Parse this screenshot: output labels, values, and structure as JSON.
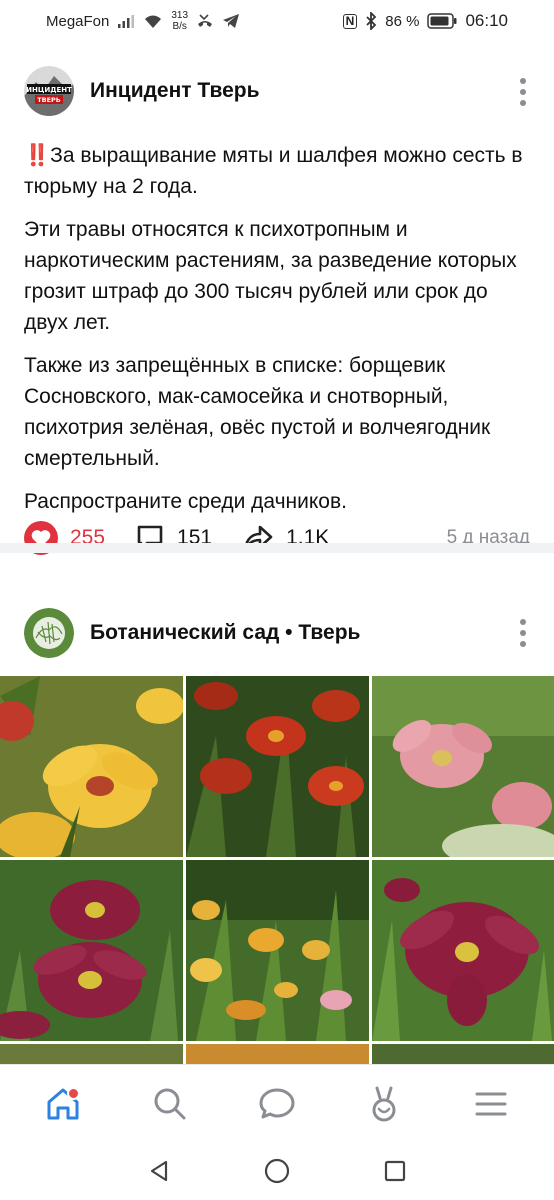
{
  "status_bar": {
    "carrier": "MegaFon",
    "net_speed_value": "313",
    "net_speed_unit": "B/s",
    "nfc": "N",
    "battery": "86 %",
    "time": "06:10"
  },
  "post1": {
    "author": "Инцидент Тверь",
    "avatar_text_1": "ИНЦИДЕНТ",
    "avatar_text_2": "ТВЕРЬ",
    "paragraph1_emoji": "‼️",
    "paragraph1": "За выращивание мяты и шалфея можно сесть в тюрьму на 2 года.",
    "paragraph2": "Эти травы относятся к психотропным и наркотическим растениям, за разведение которых грозит штраф до 300 тысяч рублей или срок до двух лет.",
    "paragraph3": "Также из запрещённых в списке: борщевик Сосновского, мак-самосейка и снотворный, психотрия зелёная, овёс пустой и волчеягодник смертельный.",
    "paragraph4": "Распространите среди дачников.",
    "likes": "255",
    "comments": "151",
    "shares": "1,1K",
    "time_ago": "5 д назад"
  },
  "post2": {
    "author": "Ботанический сад • Тверь"
  },
  "colors": {
    "like": "#e0333f",
    "accent": "#2d81e0",
    "muted": "#8a8d92",
    "badge": "#e64646"
  },
  "icons": {
    "tab_home": "home-icon",
    "tab_search": "search-icon",
    "tab_messages": "message-icon",
    "tab_clips": "clips-icon",
    "tab_menu": "menu-icon"
  }
}
